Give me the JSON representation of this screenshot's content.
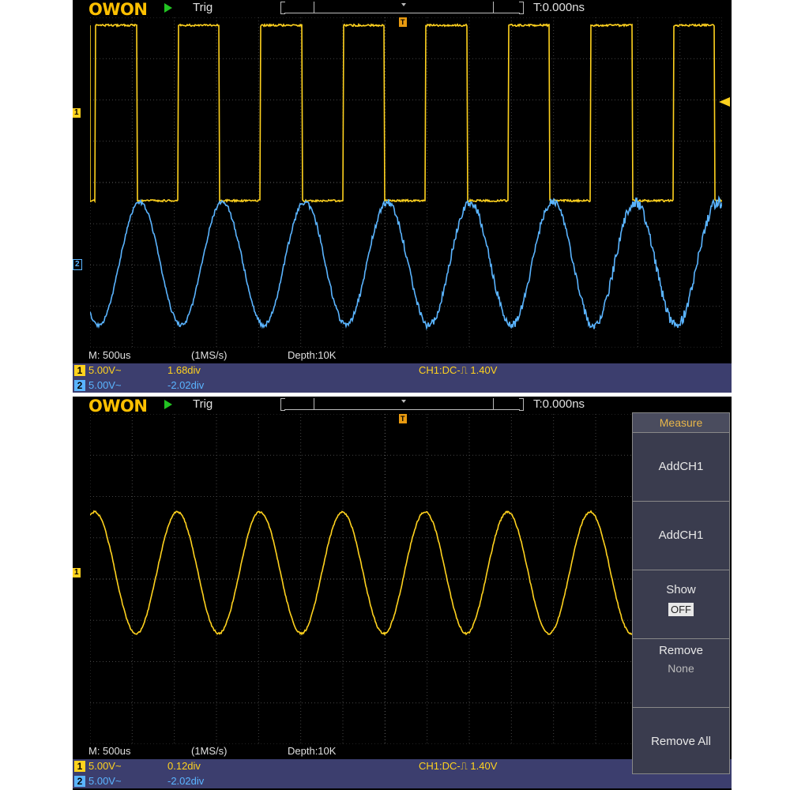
{
  "top": {
    "brand": "OWON",
    "trigger_state": "Trig",
    "trigger_delay": "T:0.000ns",
    "timebase": "M: 500us",
    "sample_rate": "(1MS/s)",
    "depth": "Depth:10K",
    "ch1": {
      "num": "1",
      "scale": "5.00V~",
      "offset": "1.68div",
      "color": "#ffd21e"
    },
    "ch2": {
      "num": "2",
      "scale": "5.00V~",
      "offset": "-2.02div",
      "color": "#5ab4ff"
    },
    "trigger_info": "CH1:DC-⎍ 1.40V",
    "ch1_marker": "1",
    "ch2_marker": "2",
    "trig_marker": "T"
  },
  "bottom": {
    "brand": "OWON",
    "trigger_state": "Trig",
    "trigger_delay": "T:0.000ns",
    "timebase": "M: 500us",
    "sample_rate": "(1MS/s)",
    "depth": "Depth:10K",
    "ch1": {
      "num": "1",
      "scale": "5.00V~",
      "offset": "0.12div",
      "color": "#ffd21e"
    },
    "ch2": {
      "num": "2",
      "scale": "5.00V~",
      "offset": "-2.02div",
      "color": "#5ab4ff"
    },
    "trigger_info": "CH1:DC-⎍ 1.40V",
    "ch1_marker": "1",
    "trig_marker": "T"
  },
  "menu": {
    "title": "Measure",
    "items": [
      {
        "label": "AddCH1"
      },
      {
        "label": "AddCH1"
      },
      {
        "label": "Show",
        "value": "OFF"
      },
      {
        "label": "Remove",
        "value": "None"
      },
      {
        "label": "Remove All"
      }
    ]
  },
  "colors": {
    "accent": "#ffc000",
    "ch1": "#ffd21e",
    "ch2": "#5ab4ff",
    "run": "#22c322"
  }
}
